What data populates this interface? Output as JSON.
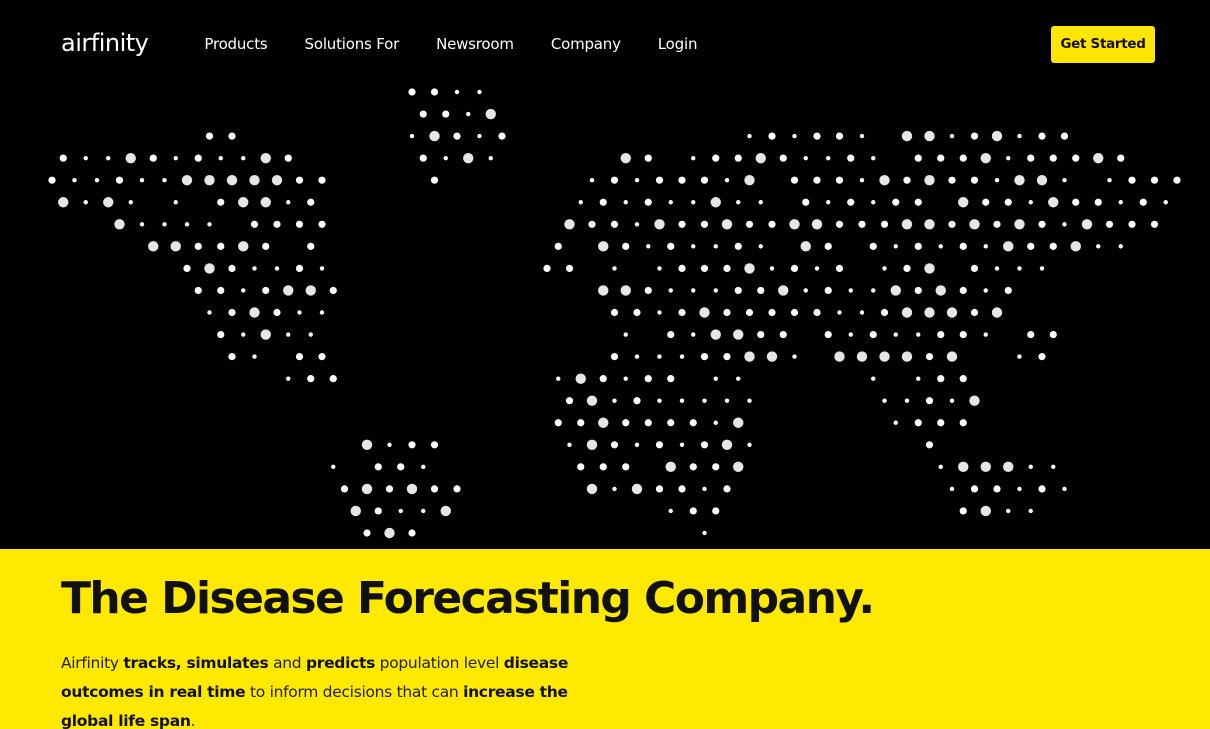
{
  "brand": {
    "logo_text": "airfinity",
    "accent_color": "#ffe900",
    "background_color": "#000000"
  },
  "nav": {
    "items": [
      "Products",
      "Solutions For",
      "Newsroom",
      "Company",
      "Login"
    ]
  },
  "cta": {
    "label": "Get Started"
  },
  "hero": {
    "title": "The Disease Forecasting Company.",
    "copy": [
      {
        "text": "Airfinity ",
        "bold": false
      },
      {
        "text": "tracks, simulates",
        "bold": true
      },
      {
        "text": " and ",
        "bold": false
      },
      {
        "text": "predicts",
        "bold": true
      },
      {
        "text": " population level ",
        "bold": false
      },
      {
        "text": "disease outcomes in real time",
        "bold": true
      },
      {
        "text": " to inform decisions that can ",
        "bold": false
      },
      {
        "text": "increase the global life span",
        "bold": true
      },
      {
        "text": ".",
        "bold": false
      }
    ]
  },
  "map": {
    "description_icon": "dotted-world-map"
  }
}
